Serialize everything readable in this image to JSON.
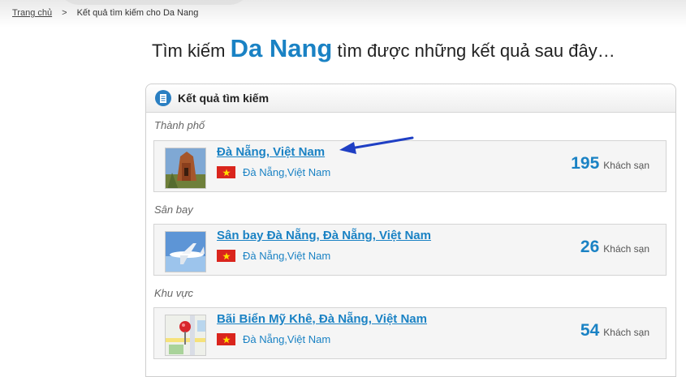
{
  "breadcrumb": {
    "home": "Trang chủ",
    "separator": ">",
    "current": "Kết quả tìm kiếm cho Da Nang"
  },
  "heading": {
    "prefix": "Tìm kiếm",
    "query": "Da Nang",
    "suffix": "tìm được những kết quả sau đây…"
  },
  "panel": {
    "title": "Kết quả tìm kiếm",
    "icon": "document-icon"
  },
  "groups": [
    {
      "label": "Thành phố",
      "result": {
        "title": "Đà Nẵng, Việt Nam",
        "location": "Đà Nẵng,Việt Nam",
        "count": "195",
        "unit": "Khách sạn",
        "thumb": "temple-photo"
      }
    },
    {
      "label": "Sân bay",
      "result": {
        "title": "Sân bay Đà Nẵng, Đà Nẵng, Việt Nam",
        "location": "Đà Nẵng,Việt Nam",
        "count": "26",
        "unit": "Khách sạn",
        "thumb": "airplane-photo"
      }
    },
    {
      "label": "Khu vực",
      "result": {
        "title": "Bãi Biển Mỹ Khê, Đà Nẵng, Việt Nam",
        "location": "Đà Nẵng,Việt Nam",
        "count": "54",
        "unit": "Khách sạn",
        "thumb": "map-pin-icon"
      }
    }
  ],
  "colors": {
    "link": "#1a82c4",
    "flag": "#da251d",
    "annotation_arrow": "#1f3fc4"
  }
}
